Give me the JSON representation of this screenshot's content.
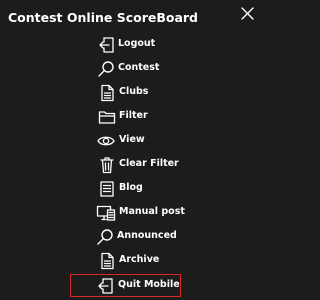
{
  "panel": {
    "title": "Contest Online ScoreBoard",
    "close_icon": "close-icon"
  },
  "menu": {
    "items": [
      {
        "label": "Logout",
        "icon": "logout-icon"
      },
      {
        "label": "Contest",
        "icon": "search-icon"
      },
      {
        "label": "Clubs",
        "icon": "document-icon"
      },
      {
        "label": "Filter",
        "icon": "folder-icon"
      },
      {
        "label": "View",
        "icon": "eye-icon"
      },
      {
        "label": "Clear Filter",
        "icon": "trash-icon"
      },
      {
        "label": "Blog",
        "icon": "notes-icon"
      },
      {
        "label": "Manual post",
        "icon": "monitor-post-icon"
      },
      {
        "label": "Announced",
        "icon": "search-icon"
      },
      {
        "label": "Archive",
        "icon": "document-icon"
      },
      {
        "label": "Quit Mobile",
        "icon": "logout-icon",
        "highlighted": true
      }
    ]
  },
  "colors": {
    "background": "#1c1c1c",
    "text": "#ffffff",
    "highlight_border": "#d62828"
  }
}
